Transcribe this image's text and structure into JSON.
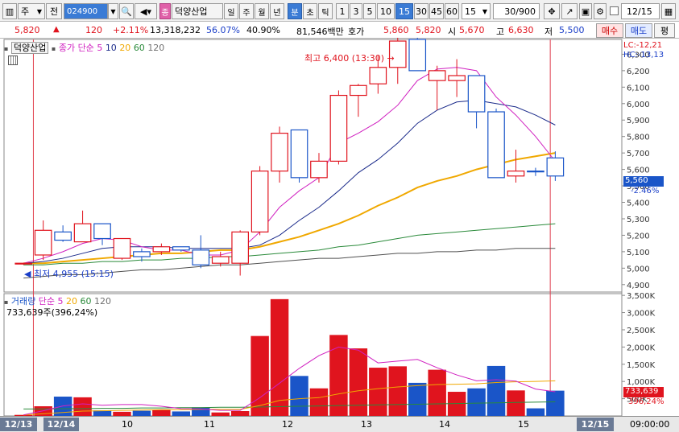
{
  "toolbar": {
    "market": "주",
    "market_alt": "전",
    "code": "024900",
    "stock_badge": "종",
    "stock_name": "덕양산업",
    "periods": [
      "일",
      "주",
      "월",
      "년",
      "분",
      "초",
      "틱"
    ],
    "active_period": "분",
    "intervals": [
      "1",
      "3",
      "5",
      "10",
      "15",
      "30",
      "45",
      "60"
    ],
    "active_interval": "15",
    "interval_value": "15",
    "count": "30/900",
    "date_value": "12/15"
  },
  "quote": {
    "price": "5,820",
    "change_arrow": "▲",
    "change": "120",
    "change_pct": "+2.11%",
    "volume": "13,318,232",
    "ratio": "56.07%",
    "turnover": "40.90%",
    "amount": "81,546백만",
    "hoga_label": "호가",
    "ask": "5,860",
    "bid": "5,820",
    "open_label": "시",
    "open": "5,670",
    "high_label": "고",
    "high": "6,630",
    "low_label": "저",
    "low": "5,500",
    "buy_button": "매수",
    "sell_button": "매도",
    "eval_button": "평"
  },
  "price_panel": {
    "stock_label": "덕양산업",
    "ma_label": "종가 단순",
    "ma_periods": [
      "5",
      "10",
      "20",
      "60",
      "120"
    ],
    "lc_label": "LC:-12,21",
    "hc_label": "HC:-13,13",
    "high_annotation": "최고 6,400 (13:30)",
    "low_annotation": "최저 4,955 (15:15)",
    "current_price": "5,560",
    "current_pct": "-2.46%",
    "y_ticks": [
      "6,300",
      "6,200",
      "6,100",
      "6,000",
      "5,900",
      "5,800",
      "5,700",
      "5,600",
      "5,500",
      "5,400",
      "5,300",
      "5,200",
      "5,100",
      "5,000",
      "4,900"
    ]
  },
  "volume_panel": {
    "label": "거래량",
    "ma_label": "단순",
    "ma_periods": [
      "5",
      "20",
      "60",
      "120"
    ],
    "volume_value": "733,639주(396,24%)",
    "current_volume": "733,639",
    "current_pct": "396,24%",
    "y_ticks": [
      "3,500K",
      "3,000K",
      "2,500K",
      "2,000K",
      "1,500K",
      "1,000K",
      "500K"
    ]
  },
  "x_axis": {
    "labels": [
      "12/13",
      "12/14",
      "10",
      "11",
      "12",
      "13",
      "14",
      "15",
      "12/15"
    ],
    "time_label": "09:00:00"
  },
  "colors": {
    "up": "#e0141e",
    "down": "#1a55c8",
    "ma5": "#d020c0",
    "ma10": "#1a2a8a",
    "ma20": "#f0a800",
    "ma60": "#2a8a3a",
    "ma120": "#505050"
  },
  "chart_data": {
    "type": "candlestick",
    "candles": [
      {
        "o": 5030,
        "h": 5030,
        "l": 5020,
        "c": 5030
      },
      {
        "o": 5080,
        "h": 5290,
        "l": 5050,
        "c": 5230
      },
      {
        "o": 5220,
        "h": 5260,
        "l": 5160,
        "c": 5170
      },
      {
        "o": 5160,
        "h": 5350,
        "l": 5160,
        "c": 5270
      },
      {
        "o": 5270,
        "h": 5270,
        "l": 5140,
        "c": 5180
      },
      {
        "o": 5180,
        "h": 5180,
        "l": 5050,
        "c": 5060
      },
      {
        "o": 5070,
        "h": 5120,
        "l": 5040,
        "c": 5100
      },
      {
        "o": 5100,
        "h": 5150,
        "l": 5080,
        "c": 5130
      },
      {
        "o": 5130,
        "h": 5130,
        "l": 5100,
        "c": 5110
      },
      {
        "o": 5110,
        "h": 5200,
        "l": 5000,
        "c": 5020
      },
      {
        "o": 5030,
        "h": 5100,
        "l": 5010,
        "c": 5070
      },
      {
        "o": 5030,
        "h": 5230,
        "l": 4955,
        "c": 5220
      },
      {
        "o": 5220,
        "h": 5620,
        "l": 5200,
        "c": 5590
      },
      {
        "o": 5590,
        "h": 5860,
        "l": 5520,
        "c": 5820
      },
      {
        "o": 5840,
        "h": 5840,
        "l": 5520,
        "c": 5550
      },
      {
        "o": 5550,
        "h": 5700,
        "l": 5520,
        "c": 5650
      },
      {
        "o": 5650,
        "h": 6080,
        "l": 5630,
        "c": 6050
      },
      {
        "o": 6050,
        "h": 6120,
        "l": 5920,
        "c": 6110
      },
      {
        "o": 6120,
        "h": 6290,
        "l": 6060,
        "c": 6220
      },
      {
        "o": 6220,
        "h": 6400,
        "l": 6120,
        "c": 6380
      },
      {
        "o": 6390,
        "h": 6400,
        "l": 6200,
        "c": 6200
      },
      {
        "o": 6200,
        "h": 6230,
        "l": 5960,
        "c": 6140
      },
      {
        "o": 6140,
        "h": 6270,
        "l": 6040,
        "c": 6170
      },
      {
        "o": 6170,
        "h": 6160,
        "l": 5850,
        "c": 5950
      },
      {
        "o": 5950,
        "h": 5970,
        "l": 5550,
        "c": 5550
      },
      {
        "o": 5560,
        "h": 5720,
        "l": 5520,
        "c": 5590
      },
      {
        "o": 5590,
        "h": 5610,
        "l": 5560,
        "c": 5590
      },
      {
        "o": 5670,
        "h": 5710,
        "l": 5530,
        "c": 5560
      }
    ],
    "up_flags": [
      1,
      1,
      0,
      1,
      0,
      1,
      0,
      1,
      0,
      0,
      1,
      1,
      1,
      1,
      0,
      1,
      1,
      1,
      1,
      1,
      0,
      1,
      1,
      0,
      0,
      1,
      0,
      0
    ],
    "volume": [
      30,
      280,
      560,
      540,
      160,
      120,
      150,
      180,
      130,
      250,
      100,
      140,
      2320,
      3390,
      1160,
      800,
      2350,
      1960,
      1400,
      1440,
      960,
      1340,
      700,
      800,
      1450,
      740,
      220,
      733
    ],
    "ma5": [
      5030,
      5060,
      5100,
      5150,
      5180,
      5170,
      5130,
      5110,
      5110,
      5080,
      5080,
      5110,
      5220,
      5370,
      5470,
      5550,
      5760,
      5820,
      5890,
      5990,
      6140,
      6210,
      6220,
      6200,
      6040,
      5930,
      5800,
      5650
    ],
    "ma10": [
      5030,
      5040,
      5060,
      5090,
      5120,
      5130,
      5130,
      5130,
      5120,
      5120,
      5120,
      5120,
      5140,
      5200,
      5290,
      5370,
      5470,
      5580,
      5660,
      5760,
      5880,
      5960,
      6010,
      6020,
      6000,
      5980,
      5930,
      5870
    ],
    "ma20": [
      5030,
      5030,
      5040,
      5050,
      5060,
      5070,
      5080,
      5090,
      5090,
      5100,
      5110,
      5110,
      5130,
      5160,
      5190,
      5230,
      5270,
      5320,
      5380,
      5430,
      5490,
      5530,
      5560,
      5600,
      5630,
      5660,
      5680,
      5700
    ],
    "ma60": [
      5020,
      5020,
      5030,
      5030,
      5040,
      5040,
      5050,
      5050,
      5060,
      5060,
      5070,
      5070,
      5080,
      5090,
      5100,
      5110,
      5130,
      5140,
      5160,
      5180,
      5200,
      5210,
      5220,
      5230,
      5240,
      5250,
      5260,
      5270
    ],
    "ma120": [
      4940,
      4950,
      4960,
      4960,
      4970,
      4980,
      4990,
      4990,
      5000,
      5010,
      5020,
      5020,
      5030,
      5040,
      5050,
      5060,
      5060,
      5070,
      5080,
      5090,
      5090,
      5100,
      5100,
      5110,
      5110,
      5120,
      5120,
      5120
    ],
    "vol_ma5": [
      30,
      150,
      290,
      350,
      310,
      330,
      330,
      280,
      210,
      200,
      160,
      160,
      530,
      950,
      1380,
      1750,
      2000,
      1910,
      1540,
      1590,
      1640,
      1400,
      1190,
      1020,
      1050,
      1010,
      780,
      700
    ],
    "vol_ma20": [
      30,
      60,
      100,
      140,
      150,
      160,
      170,
      180,
      180,
      190,
      190,
      190,
      300,
      450,
      500,
      530,
      640,
      730,
      790,
      840,
      880,
      910,
      920,
      930,
      970,
      990,
      1000,
      1020
    ],
    "vol_ma60": [
      200,
      200,
      210,
      210,
      220,
      220,
      230,
      230,
      240,
      240,
      250,
      250,
      260,
      270,
      280,
      290,
      300,
      310,
      320,
      330,
      340,
      350,
      360,
      370,
      380,
      390,
      400,
      410
    ],
    "ylim_price": [
      4855,
      6390
    ],
    "ylim_volume": [
      0,
      3550
    ]
  }
}
